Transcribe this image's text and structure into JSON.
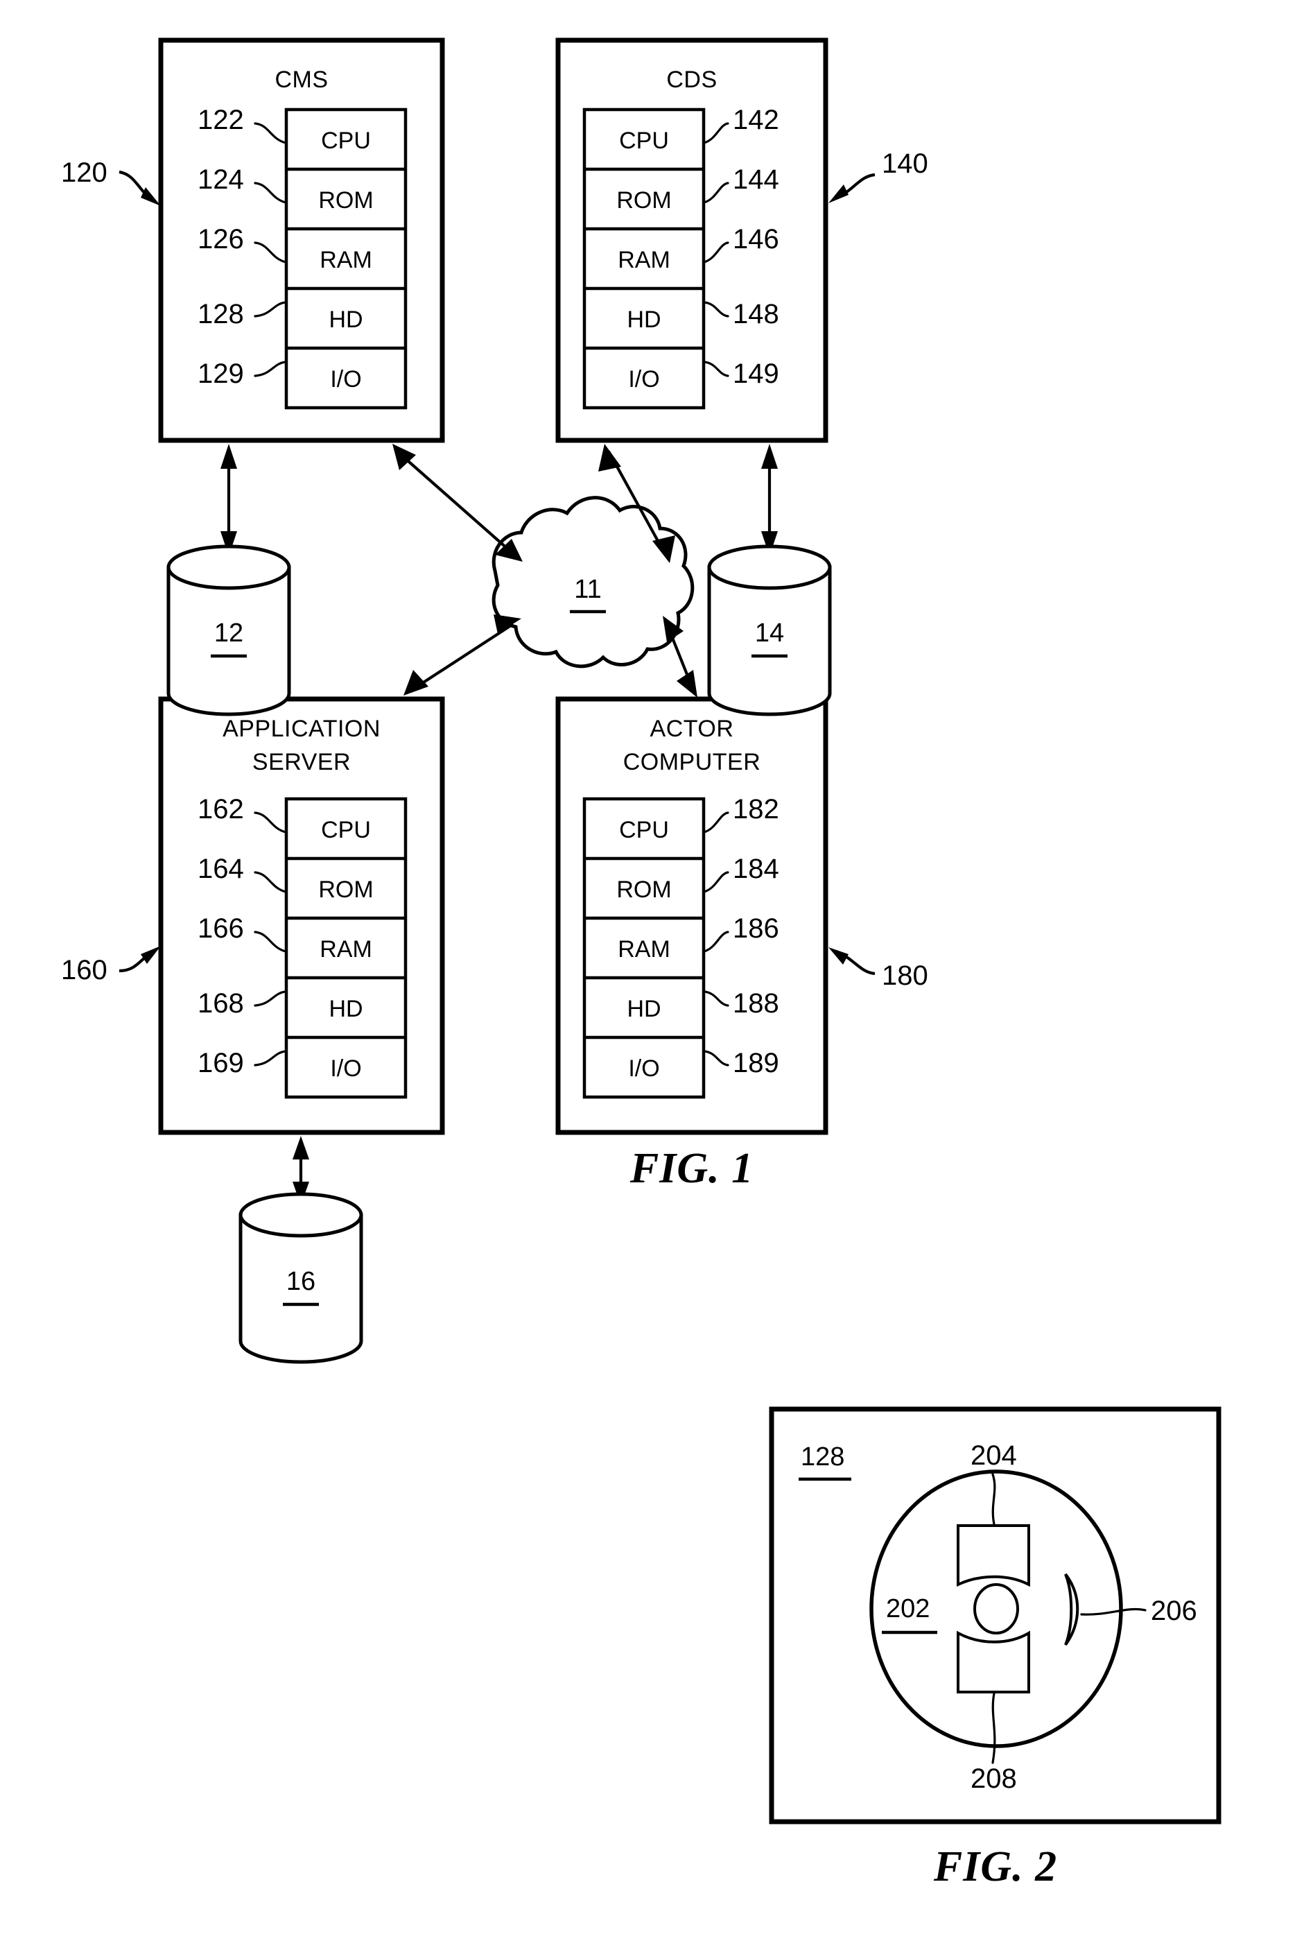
{
  "document": {
    "kind": "patent-drawing-sheet",
    "figures": [
      "FIG. 1",
      "FIG. 2"
    ]
  },
  "fig1": {
    "caption": "FIG. 1",
    "component_rows": [
      "CPU",
      "ROM",
      "RAM",
      "HD",
      "I/O"
    ],
    "blocks": [
      {
        "id": "cms",
        "title": "CMS",
        "title_lines": [
          "CMS"
        ],
        "outer_ref": "120",
        "outer_ref_side": "left",
        "rows": [
          {
            "label": "CPU",
            "ref": "122",
            "ref_side": "left"
          },
          {
            "label": "ROM",
            "ref": "124",
            "ref_side": "left"
          },
          {
            "label": "RAM",
            "ref": "126",
            "ref_side": "left"
          },
          {
            "label": "HD",
            "ref": "128",
            "ref_side": "left"
          },
          {
            "label": "I/O",
            "ref": "129",
            "ref_side": "left"
          }
        ]
      },
      {
        "id": "cds",
        "title": "CDS",
        "title_lines": [
          "CDS"
        ],
        "outer_ref": "140",
        "outer_ref_side": "right",
        "rows": [
          {
            "label": "CPU",
            "ref": "142",
            "ref_side": "right"
          },
          {
            "label": "ROM",
            "ref": "144",
            "ref_side": "right"
          },
          {
            "label": "RAM",
            "ref": "146",
            "ref_side": "right"
          },
          {
            "label": "HD",
            "ref": "148",
            "ref_side": "right"
          },
          {
            "label": "I/O",
            "ref": "149",
            "ref_side": "right"
          }
        ]
      },
      {
        "id": "application-server",
        "title": "APPLICATION SERVER",
        "title_lines": [
          "APPLICATION",
          "SERVER"
        ],
        "outer_ref": "160",
        "outer_ref_side": "left",
        "rows": [
          {
            "label": "CPU",
            "ref": "162",
            "ref_side": "left"
          },
          {
            "label": "ROM",
            "ref": "164",
            "ref_side": "left"
          },
          {
            "label": "RAM",
            "ref": "166",
            "ref_side": "left"
          },
          {
            "label": "HD",
            "ref": "168",
            "ref_side": "left"
          },
          {
            "label": "I/O",
            "ref": "169",
            "ref_side": "left"
          }
        ]
      },
      {
        "id": "actor-computer",
        "title": "ACTOR COMPUTER",
        "title_lines": [
          "ACTOR",
          "COMPUTER"
        ],
        "outer_ref": "180",
        "outer_ref_side": "right",
        "rows": [
          {
            "label": "CPU",
            "ref": "182",
            "ref_side": "right"
          },
          {
            "label": "ROM",
            "ref": "184",
            "ref_side": "right"
          },
          {
            "label": "RAM",
            "ref": "186",
            "ref_side": "right"
          },
          {
            "label": "HD",
            "ref": "188",
            "ref_side": "right"
          },
          {
            "label": "I/O",
            "ref": "189",
            "ref_side": "right"
          }
        ]
      }
    ],
    "network": {
      "id": "network-cloud",
      "ref": "11"
    },
    "databases": [
      {
        "id": "cms-database",
        "ref": "12",
        "attached_to": "cms"
      },
      {
        "id": "cds-database",
        "ref": "14",
        "attached_to": "cds"
      },
      {
        "id": "application-server-database",
        "ref": "16",
        "attached_to": "application-server"
      }
    ]
  },
  "fig2": {
    "caption": "FIG. 2",
    "enclosure_ref": "128",
    "parts": [
      {
        "id": "platter",
        "ref": "202"
      },
      {
        "id": "upper-sector",
        "ref": "204"
      },
      {
        "id": "read-write-head",
        "ref": "206"
      },
      {
        "id": "lower-sector",
        "ref": "208"
      }
    ]
  },
  "colors": {
    "ink": "#000000",
    "paper": "#ffffff"
  }
}
